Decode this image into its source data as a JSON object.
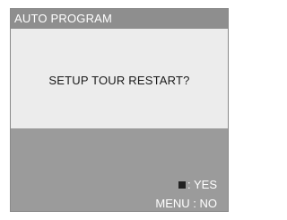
{
  "dialog": {
    "title": "AUTO PROGRAM",
    "message": "SETUP TOUR RESTART?",
    "yes_option": {
      "icon": "square-icon",
      "label": ": YES"
    },
    "no_option": {
      "label": "MENU : NO"
    }
  },
  "colors": {
    "title_bar": "#8e8e8e",
    "message_panel": "#ececec",
    "footer": "#9b9b9b",
    "text_light": "#ffffff",
    "text_dark": "#1a1a1a"
  }
}
